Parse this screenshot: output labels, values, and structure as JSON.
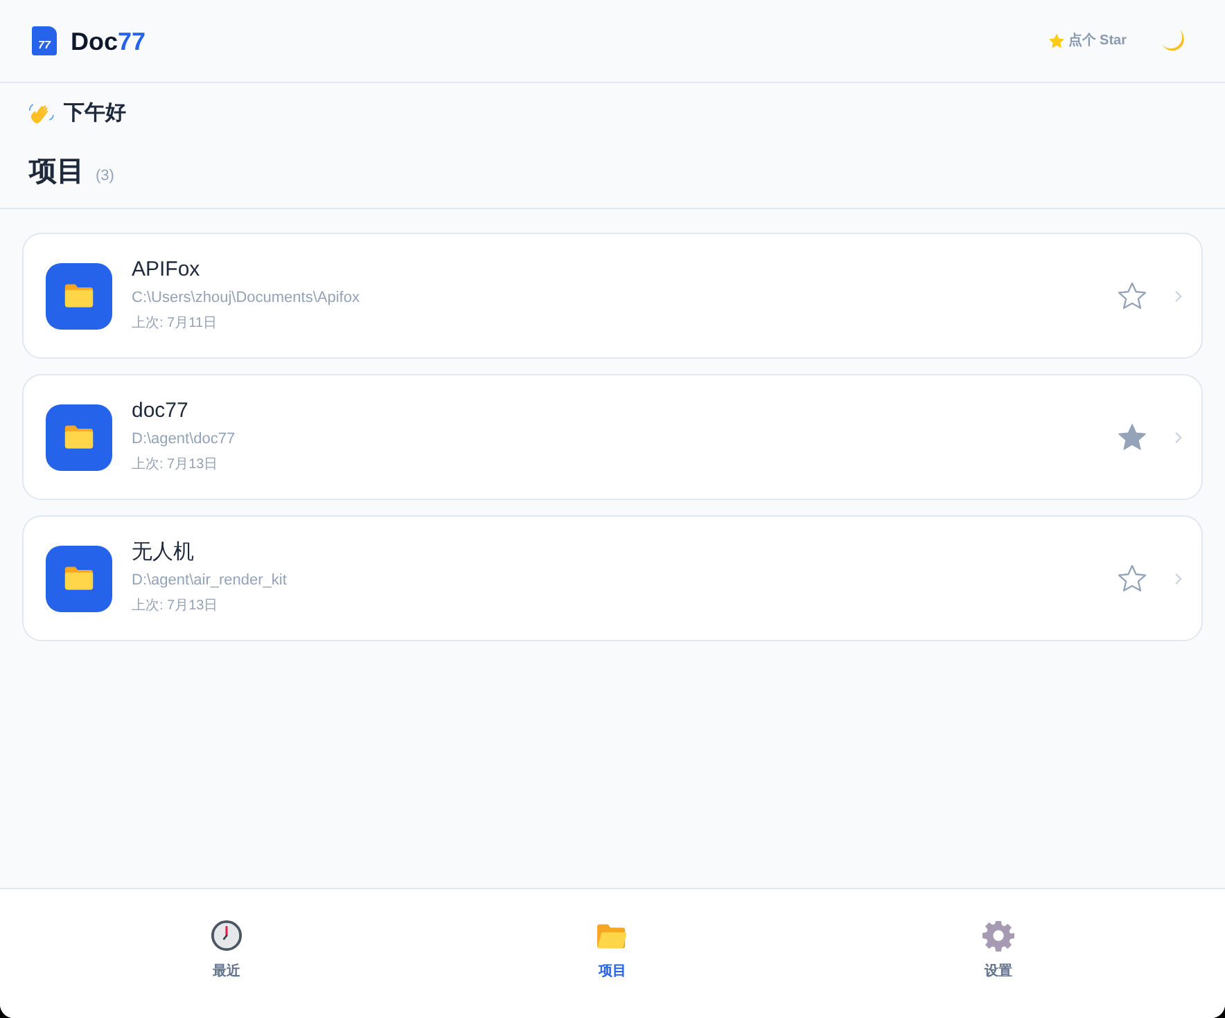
{
  "header": {
    "logo_mark": "77",
    "brand": "Doc",
    "brand_accent": "77",
    "star_button": "点个 Star"
  },
  "greeting": "下午好",
  "section": {
    "title": "项目",
    "count": "(3)"
  },
  "projects": [
    {
      "name": "APIFox",
      "path": "C:\\Users\\zhouj\\Documents\\Apifox",
      "last_opened": "上次: 7月11日",
      "starred": false
    },
    {
      "name": "doc77",
      "path": "D:\\agent\\doc77",
      "last_opened": "上次: 7月13日",
      "starred": true
    },
    {
      "name": "无人机",
      "path": "D:\\agent\\air_render_kit",
      "last_opened": "上次: 7月13日",
      "starred": false
    }
  ],
  "nav": [
    {
      "label": "最近",
      "kind": "clock",
      "selected": false
    },
    {
      "label": "项目",
      "kind": "folder",
      "selected": true
    },
    {
      "label": "设置",
      "kind": "gear",
      "selected": false
    }
  ]
}
